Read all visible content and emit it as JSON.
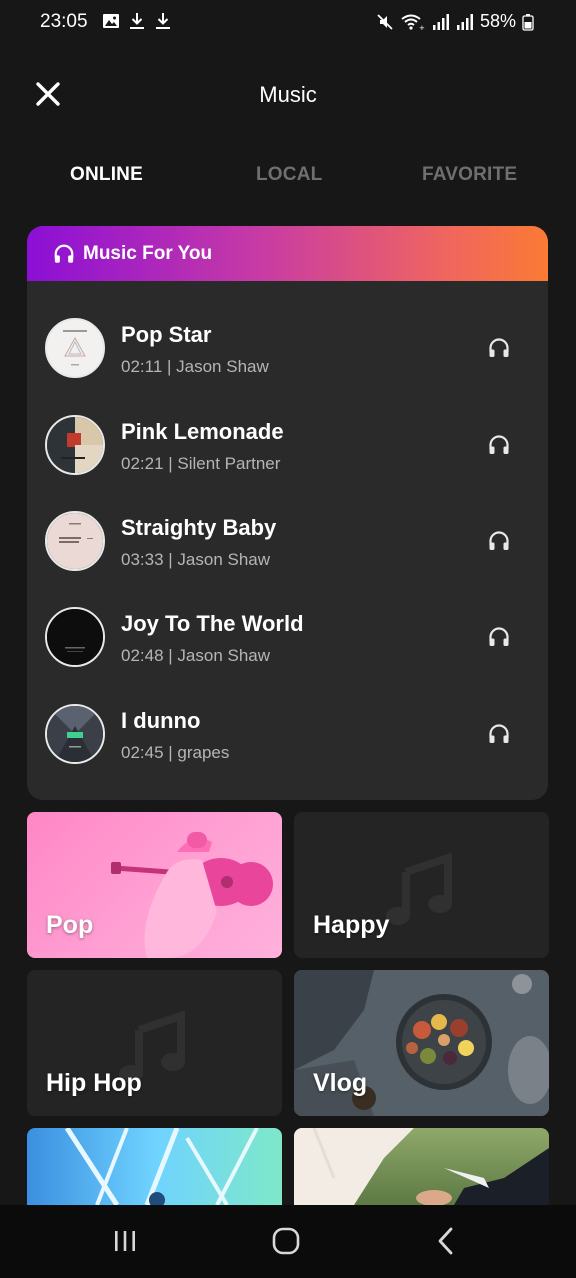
{
  "status_bar": {
    "time": "23:05",
    "battery": "58%",
    "left_icons": [
      "image-icon",
      "download-icon",
      "download-icon"
    ],
    "right_icons": [
      "mute-icon",
      "wifi-icon",
      "signal-icon",
      "signal-icon",
      "battery-icon"
    ]
  },
  "header": {
    "title": "Music",
    "close_icon": "close-icon"
  },
  "tabs": [
    {
      "label": "ONLINE",
      "active": true
    },
    {
      "label": "LOCAL",
      "active": false
    },
    {
      "label": "FAVORITE",
      "active": false
    }
  ],
  "recommended": {
    "title": "Music For You",
    "icon": "headphones-icon",
    "tracks": [
      {
        "title": "Pop Star",
        "meta": "02:11 | Jason Shaw"
      },
      {
        "title": "Pink Lemonade",
        "meta": "02:21 | Silent Partner"
      },
      {
        "title": "Straighty Baby",
        "meta": "03:33 | Jason Shaw"
      },
      {
        "title": "Joy To The World",
        "meta": "02:48 | Jason Shaw"
      },
      {
        "title": "I dunno",
        "meta": "02:45 | grapes"
      }
    ]
  },
  "categories": [
    {
      "label": "Pop"
    },
    {
      "label": "Happy"
    },
    {
      "label": "Hip Hop"
    },
    {
      "label": "Vlog"
    },
    {
      "label": ""
    },
    {
      "label": ""
    }
  ],
  "nav_bar": {
    "icons": [
      "recents-icon",
      "home-icon",
      "back-icon"
    ]
  },
  "colors": {
    "background": "#171717",
    "card": "#2a2a2a",
    "accent_gradient_start": "#8b0fd6",
    "accent_gradient_end": "#fb7a34",
    "tab_inactive": "#6f6f6f"
  }
}
